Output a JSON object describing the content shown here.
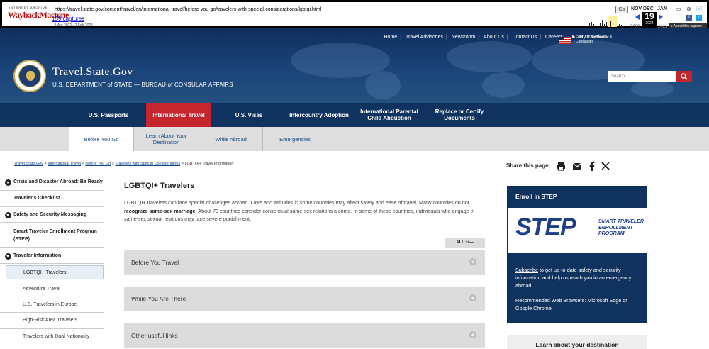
{
  "wayback": {
    "logo_top": "INTERNET ARCHIVE",
    "logo_main": "WaybackMachine",
    "url": "https://travel.state.gov/content/travel/en/international-travel/before-you-go/travelers-with-special-considerations/lgbtqi.html",
    "go_label": "Go",
    "captures_label": "159 captures",
    "date_range": "1 Apr 2022 - 2 Feb 2025",
    "prev_month": "NOV",
    "cur_month": "DEC",
    "next_month": "JAN",
    "day": "19",
    "year": "2024",
    "prev_year": "2023",
    "next_year": "2025",
    "about_label": "About this capture"
  },
  "header": {
    "utility_links": [
      "Home",
      "Travel Advisories",
      "Newsroom",
      "About Us",
      "Contact Us",
      "Careers",
      "MyTravelGov"
    ],
    "embassy_label": "Find U.S. Embassies & Consulates",
    "site_title": "Travel.State.Gov",
    "site_subtitle": "U.S. DEPARTMENT of STATE — BUREAU of CONSULAR AFFAIRS",
    "search_placeholder": "Search"
  },
  "nav": {
    "items": [
      "U.S. Passports",
      "International Travel",
      "U.S. Visas",
      "Intercountry Adoption",
      "International Parental Child Abduction",
      "Replace or Certify Documents"
    ],
    "active": "International Travel"
  },
  "subnav": {
    "items": [
      "Before You Go",
      "Learn About Your Destination",
      "While Abroad",
      "Emergencies"
    ]
  },
  "breadcrumb": {
    "links": [
      "Travel.State.Gov",
      "International Travel",
      "Before You Go",
      "Travelers with Special Considerations"
    ],
    "current": "LGBTQI+ Travel Information"
  },
  "share": {
    "label": "Share this page:"
  },
  "sidebar": {
    "items": [
      "Crisis and Disaster Abroad: Be Ready",
      "Traveler's Checklist",
      "Safety and Security Messaging",
      "Smart Traveler Enrollment Program (STEP)",
      "Traveler Information",
      "LGBTQI+ Travelers",
      "Adventure Travel",
      "U.S. Travelers in Europe",
      "High-Risk Area Travelers",
      "Travelers with Dual Nationality"
    ]
  },
  "content": {
    "title": "LGBTQI+ Travelers",
    "intro_a": "LGBTQI+ travelers can face special challenges abroad. Laws and attitudes in some countries may affect safety and ease of travel. Many countries do not ",
    "intro_b": "recognize same-sex marriage",
    "intro_c": ". About 70 countries consider consensual same-sex relations a crime. In some of these countries, individuals who engage in same-sex sexual relations may face severe punishment.",
    "all_label": "ALL +/—",
    "accordions": [
      "Before You Travel",
      "While You Are There",
      "Other useful links"
    ]
  },
  "step_card": {
    "heading": "Enroll in STEP",
    "logo_big": "STEP",
    "logo_small": "SMART TRAVELER ENROLLMENT PROGRAM",
    "subscribe_link": "Subscribe",
    "body1": " to get up-to-date safety and security information and help us reach you in an emergency abroad.",
    "body2": "Recommended Web Browsers: Microsoft Edge or Google Chrome."
  },
  "destination_card": {
    "heading": "Learn about your destination"
  },
  "colors": {
    "navy": "#10325f",
    "red": "#c5262d",
    "gray": "#dcdcdc"
  }
}
